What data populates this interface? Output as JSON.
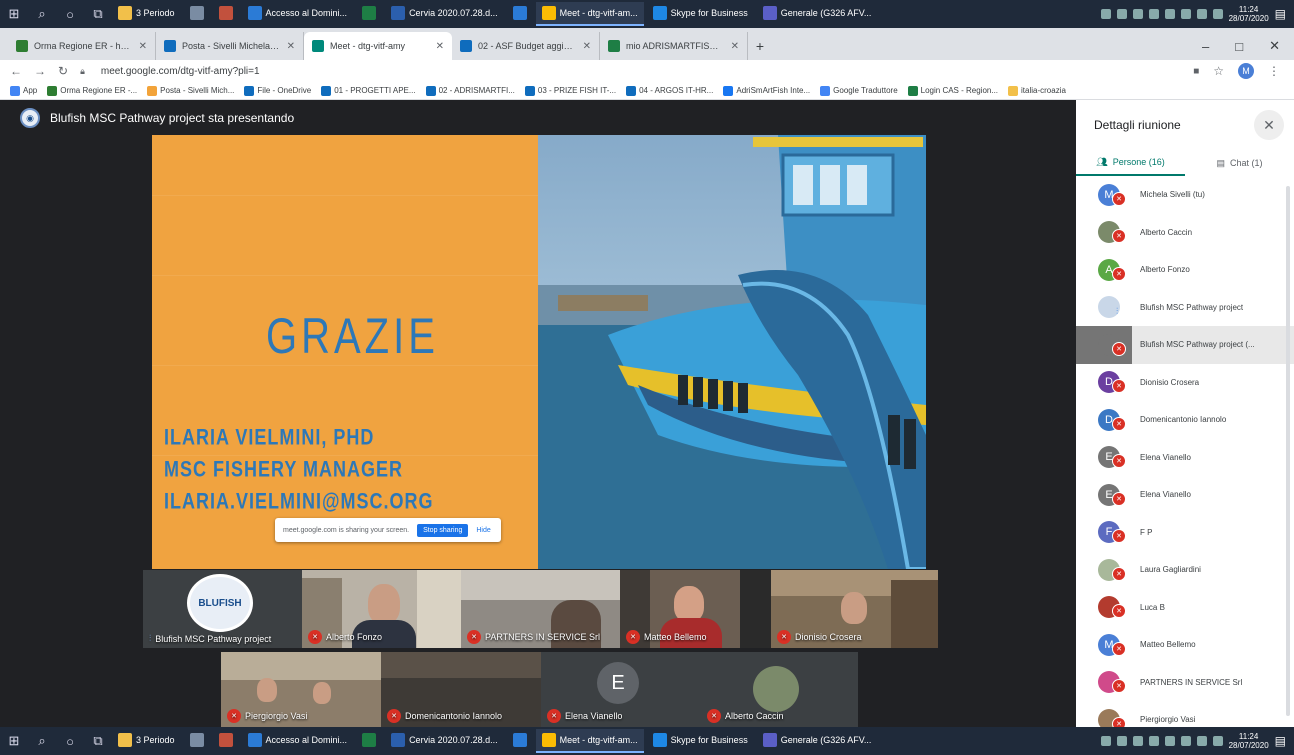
{
  "taskbar": {
    "items": [
      {
        "label": "3 Periodo",
        "color": "#f2c04a"
      },
      {
        "label": "",
        "color": "#7a8ca3"
      },
      {
        "label": "",
        "color": "#c2513d"
      },
      {
        "label": "Accesso al Domini...",
        "color": "#2b7bd6"
      },
      {
        "label": "",
        "color": "#1e7e45"
      },
      {
        "label": "Cervia 2020.07.28.d...",
        "color": "#2b5fad"
      },
      {
        "label": "",
        "color": "#2b7bd6"
      },
      {
        "label": "Meet - dtg-vitf-am...",
        "color": "#fbbc04"
      },
      {
        "label": "Skype for Business",
        "color": "#1e88e5"
      },
      {
        "label": "Generale (G326 AFV...",
        "color": "#5b5fc7"
      }
    ],
    "clock_time": "11:24",
    "clock_date": "28/07/2020"
  },
  "browser": {
    "tabs": [
      {
        "label": "Orma Regione ER - home",
        "color": "#2e7d32"
      },
      {
        "label": "Posta - Sivelli Michela - Outlook",
        "color": "#0f6cbd"
      },
      {
        "label": "Meet - dtg-vitf-amy",
        "color": "#00897b"
      },
      {
        "label": "02 - ASF Budget aggiornato - O",
        "color": "#0f6cbd"
      },
      {
        "label": "mio ADRISMARTFISH_Budget_",
        "color": "#1e7e45"
      }
    ],
    "new_tab": "+",
    "minimize": "–",
    "maximize": "□",
    "close": "✕",
    "url": "meet.google.com/dtg-vitf-amy?pli=1",
    "profile_initial": "M",
    "bookmarks": [
      {
        "label": "App",
        "color": "#4285f4"
      },
      {
        "label": "Orma Regione ER -...",
        "color": "#2e7d32"
      },
      {
        "label": "Posta - Sivelli Mich...",
        "color": "#f2a33a"
      },
      {
        "label": "File - OneDrive",
        "color": "#0f6cbd"
      },
      {
        "label": "01 - PROGETTI APE...",
        "color": "#0f6cbd"
      },
      {
        "label": "02 - ADRISMARTFI...",
        "color": "#0f6cbd"
      },
      {
        "label": "03 - PRIZE FISH IT-...",
        "color": "#0f6cbd"
      },
      {
        "label": "04 - ARGOS IT-HR...",
        "color": "#0f6cbd"
      },
      {
        "label": "AdriSmArtFish Inte...",
        "color": "#1877f2"
      },
      {
        "label": "Google Traduttore",
        "color": "#4285f4"
      },
      {
        "label": "Login CAS - Region...",
        "color": "#1e7e45"
      },
      {
        "label": "italia-croazia",
        "color": "#f2c04a"
      }
    ]
  },
  "meet": {
    "presenter_banner": "Blufish MSC Pathway project sta presentando",
    "slide": {
      "title": "GRAZIE",
      "lines": [
        "ILARIA VIELMINI, PHD",
        "MSC FISHERY MANAGER",
        "ILARIA.VIELMINI@MSC.ORG"
      ]
    },
    "share_notice": {
      "text": "meet.google.com is sharing your screen.",
      "stop": "Stop sharing",
      "hide": "Hide"
    },
    "tiles": [
      {
        "name": "Blufish MSC Pathway project",
        "muted": false
      },
      {
        "name": "Alberto Fonzo",
        "muted": true
      },
      {
        "name": "PARTNERS IN SERVICE Srl",
        "muted": true
      },
      {
        "name": "Matteo Bellemo",
        "muted": true
      },
      {
        "name": "Dionisio Crosera",
        "muted": true
      },
      {
        "name": "Piergiorgio Vasi",
        "muted": true
      },
      {
        "name": "Domenicantonio Iannolo",
        "muted": true
      },
      {
        "name": "Elena Vianello",
        "muted": true,
        "initial": "E"
      },
      {
        "name": "Alberto Caccin",
        "muted": true
      }
    ]
  },
  "panel": {
    "title": "Dettagli riunione",
    "tab_people": "Persone (16)",
    "tab_chat": "Chat (1)",
    "people": [
      {
        "name": "Michela Sivelli (tu)",
        "initial": "M",
        "color": "#4a7fd6"
      },
      {
        "name": "Alberto Caccin",
        "initial": "",
        "color": "#7b8a6a"
      },
      {
        "name": "Alberto Fonzo",
        "initial": "A",
        "color": "#5aa845"
      },
      {
        "name": "Blufish MSC Pathway project",
        "initial": "",
        "color": "#c9d7e8"
      },
      {
        "name": "Blufish MSC Pathway project (...",
        "initial": "",
        "color": "#757575"
      },
      {
        "name": "Dionisio Crosera",
        "initial": "D",
        "color": "#6b3fa0"
      },
      {
        "name": "Domenicantonio Iannolo",
        "initial": "D",
        "color": "#3b78c4"
      },
      {
        "name": "Elena Vianello",
        "initial": "E",
        "color": "#757575"
      },
      {
        "name": "Elena Vianello",
        "initial": "E",
        "color": "#757575"
      },
      {
        "name": "F P",
        "initial": "F",
        "color": "#5c6bc0"
      },
      {
        "name": "Laura Gagliardini",
        "initial": "",
        "color": "#a8b89a"
      },
      {
        "name": "Luca B",
        "initial": "",
        "color": "#b33b2e"
      },
      {
        "name": "Matteo Bellemo",
        "initial": "M",
        "color": "#4a7fd6"
      },
      {
        "name": "PARTNERS IN SERVICE Srl",
        "initial": "",
        "color": "#d04a8a"
      },
      {
        "name": "Piergiorgio Vasi",
        "initial": "",
        "color": "#9a7a5a"
      }
    ]
  }
}
